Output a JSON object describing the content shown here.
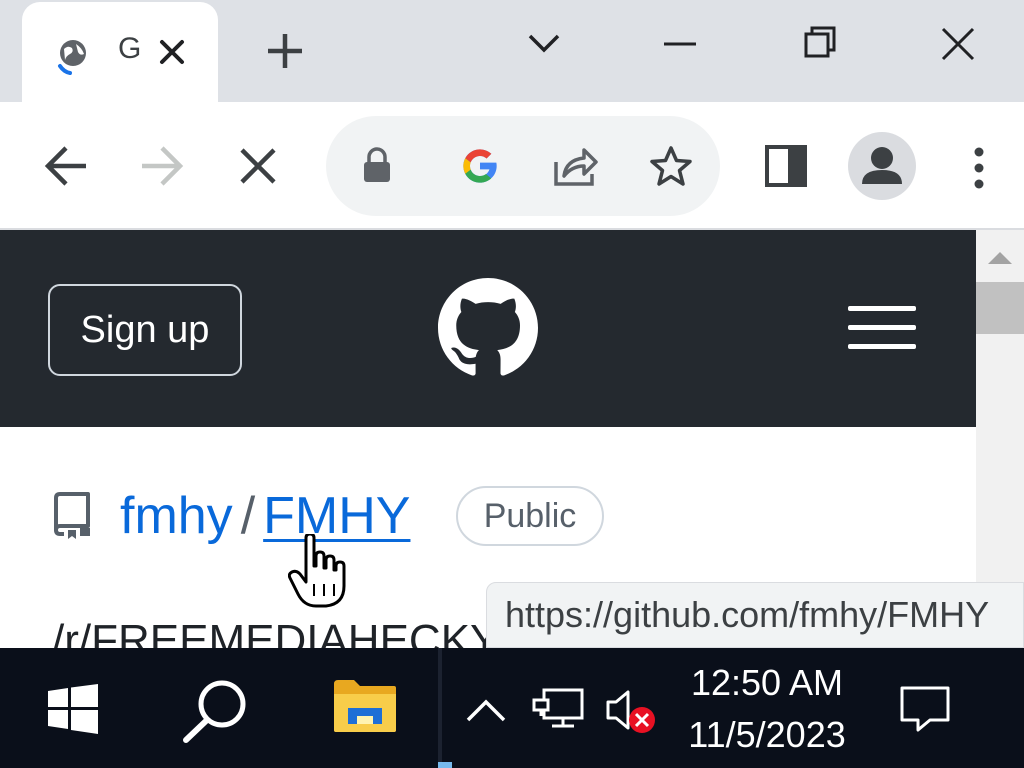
{
  "browser": {
    "tab": {
      "title": "G",
      "loading": true
    },
    "window_controls": [
      "tab-search",
      "minimize",
      "restore",
      "close"
    ],
    "toolbar": {
      "back": "back-arrow-icon",
      "forward": "forward-arrow-icon",
      "stop": "stop-icon",
      "omnibox_icons": [
        "lock-icon",
        "google-icon",
        "share-icon",
        "bookmark-star-icon"
      ],
      "side_panel": "side-panel-icon",
      "profile": "profile-avatar-icon",
      "menu": "kebab-menu-icon"
    },
    "status_url": "https://github.com/fmhy/FMHY"
  },
  "page": {
    "header": {
      "signup_label": "Sign up",
      "logo": "github-mark-icon",
      "menu": "hamburger-icon"
    },
    "repo": {
      "owner": "fmhy",
      "separator": "/",
      "name": "FMHY",
      "visibility": "Public"
    },
    "description_partial": "/r/FREEMEDIAHECKY"
  },
  "taskbar": {
    "time": "12:50 AM",
    "date": "11/5/2023",
    "items": [
      "windows-start-icon",
      "search-icon",
      "file-explorer-icon"
    ],
    "tray": [
      "chevron-up-icon",
      "network-icon",
      "volume-muted-icon",
      "notification-icon"
    ]
  },
  "colors": {
    "github_header": "#24292f",
    "link_blue": "#0969da",
    "taskbar_bg": "#0a0f1a",
    "tabstrip_bg": "#dee1e6"
  }
}
